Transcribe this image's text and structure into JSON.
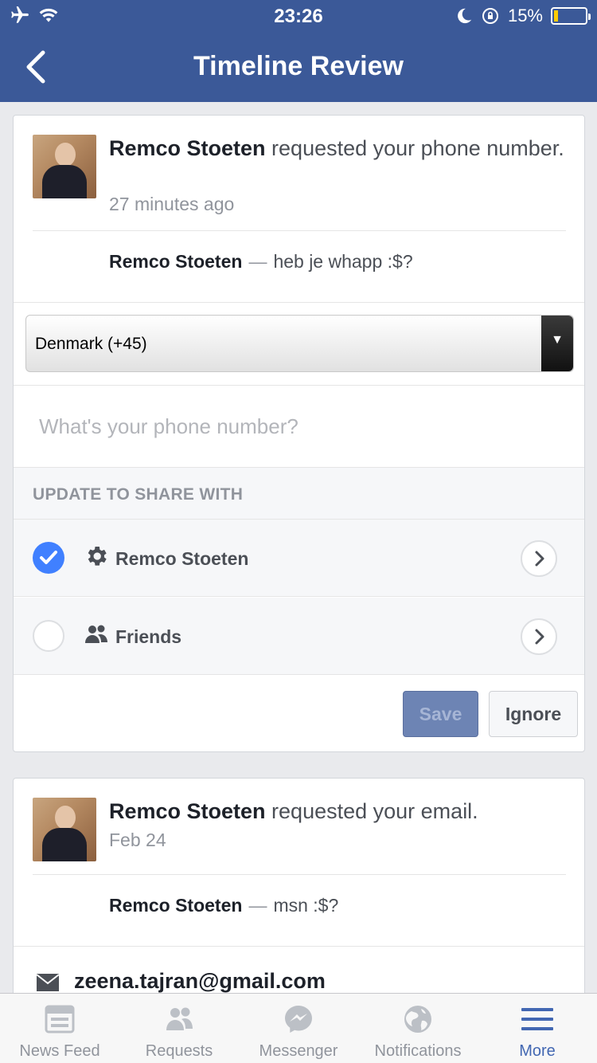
{
  "status_bar": {
    "time": "23:26",
    "battery": "15%"
  },
  "nav": {
    "title": "Timeline Review"
  },
  "requests": [
    {
      "requester": "Remco Stoeten",
      "action": " requested your phone number.",
      "time": "27 minutes ago",
      "comment_name": "Remco Stoeten",
      "comment_sep": "—",
      "comment": "heb je whapp :$?"
    },
    {
      "requester": "Remco Stoeten",
      "action": " requested your email.",
      "time": "Feb 24",
      "comment_name": "Remco Stoeten",
      "comment_sep": "—",
      "comment": "msn :$?",
      "email": "zeena.tajran@gmail.com"
    }
  ],
  "phone_form": {
    "country": "Denmark (+45)",
    "placeholder": "What's your phone number?",
    "share_header": "UPDATE TO SHARE WITH",
    "options": [
      {
        "label": "Remco Stoeten",
        "icon": "gear-icon",
        "selected": true
      },
      {
        "label": "Friends",
        "icon": "friends-icon",
        "selected": false
      }
    ],
    "save_label": "Save",
    "ignore_label": "Ignore"
  },
  "tabbar": {
    "tabs": [
      {
        "label": "News Feed",
        "icon": "news-feed-icon",
        "active": false
      },
      {
        "label": "Requests",
        "icon": "requests-icon",
        "active": false
      },
      {
        "label": "Messenger",
        "icon": "messenger-icon",
        "active": false
      },
      {
        "label": "Notifications",
        "icon": "globe-icon",
        "active": false
      },
      {
        "label": "More",
        "icon": "menu-icon",
        "active": true
      }
    ]
  },
  "colors": {
    "brand": "#3b5998",
    "accent": "#4080ff",
    "active_tab": "#4267b2"
  }
}
